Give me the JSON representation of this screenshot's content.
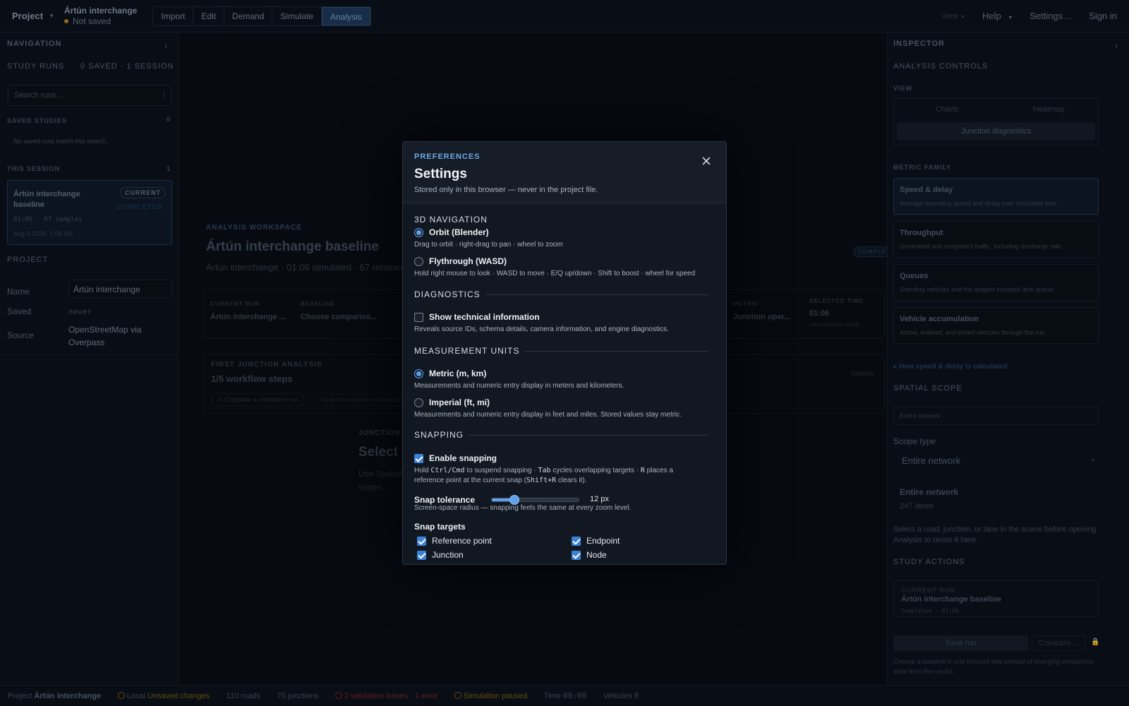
{
  "topbar": {
    "project_menu": "Project",
    "file_name": "Ártún interchange",
    "file_status": "Not saved",
    "menu": [
      "Import",
      "Edit",
      "Demand",
      "Simulate",
      "Analysis"
    ],
    "view": "View",
    "help": "Help",
    "settings": "Settings…",
    "sign_in": "Sign in"
  },
  "left": {
    "nav_title": "NAVIGATION",
    "study_runs": "STUDY RUNS",
    "study_counts": "0 SAVED · 1 SESSION",
    "search_placeholder": "Search runs…",
    "search_key": "/",
    "saved_studies": "SAVED STUDIES",
    "saved_count": "0",
    "no_saved": "No saved runs match this search.",
    "this_session": "THIS SESSION",
    "session_count": "1",
    "run": {
      "name": "Ártún interchange baseline",
      "badge": "CURRENT",
      "status": "COMPLETED",
      "meta": "01:06 · 67 samples",
      "date": "Aug 2 2026, 1:08 AM"
    },
    "project_title": "PROJECT",
    "name_label": "Name",
    "name_value": "Ártún interchange",
    "saved_label": "Saved",
    "saved_value": "never",
    "source_label": "Source",
    "source_value": "OpenStreetMap via Overpass"
  },
  "main": {
    "kicker": "ANALYSIS WORKSPACE",
    "title": "Ártún interchange baseline",
    "subtitle": "Ártún interchange · 01:06 simulated · 67 retained",
    "completed": "COMPLETED",
    "cards": [
      {
        "label": "CURRENT RUN",
        "value": "Ártún interchange ..."
      },
      {
        "label": "BASELINE",
        "value": "Choose compariso..."
      },
      {
        "label": "METRIC",
        "value": "Junction oper..."
      },
      {
        "label": "SELECTED TIME",
        "value": "01:06",
        "note": "Latest retained sample"
      }
    ],
    "workflow_kicker": "FIRST JUNCTION ANALYSIS",
    "workflow_title": "1/5 workflow steps",
    "workflow_dismiss": "Dismiss",
    "workflow_steps": [
      "Complete a simulation run",
      "Save the baseline comparison"
    ],
    "junction_kicker": "JUNCTION",
    "junction_title": "Select a",
    "junction_desc": "Use Spatial scope... substituted..."
  },
  "right": {
    "title": "INSPECTOR",
    "analysis_controls": "ANALYSIS CONTROLS",
    "view_label": "VIEW",
    "view_tabs": [
      "Charts",
      "Heatmap"
    ],
    "view_active": "Junction diagnostics",
    "metric_family": "METRIC FAMILY",
    "metrics": [
      {
        "title": "Speed & delay",
        "desc": "Average operating speed and delay over simulated time."
      },
      {
        "title": "Throughput",
        "desc": "Generated and completed traffic, including discharge rate."
      },
      {
        "title": "Queues",
        "desc": "Standing vehicles and the longest included lane queue."
      },
      {
        "title": "Vehicle accumulation",
        "desc": "Active, entered, and exited vehicles through the run."
      }
    ],
    "how_link": "How speed & delay is calculated",
    "spatial_scope": "SPATIAL SCOPE",
    "scope_chip": "Entire network",
    "scope_type_label": "Scope type",
    "scope_type_value": "Entire network",
    "scope_name": "Entire network",
    "scope_lanes": "247 lanes",
    "scope_hint": "Select a road, junction, or lane in the scene before opening Analysis to reuse it here.",
    "study_actions": "STUDY ACTIONS",
    "current_run_label": "CURRENT RUN",
    "current_run_name": "Ártún interchange baseline",
    "current_run_meta": "Completed · 01:06",
    "save_run": "Save run",
    "compare": "Compare…",
    "baseline_hint": "Choose a baseline in one focused step instead of changing comparison state from the run list."
  },
  "status": {
    "project_label": "Project",
    "project_name": "Ártún interchange",
    "local": "Local",
    "unsaved": "Unsaved changes",
    "roads": "110 roads",
    "junctions": "75 junctions",
    "validation": "2 validation issues · 1 error",
    "sim": "Simulation paused",
    "time_label": "Time",
    "time_value": "00:00",
    "vehicles_label": "Vehicles",
    "vehicles_value": "0"
  },
  "modal": {
    "kicker": "PREFERENCES",
    "title": "Settings",
    "subtitle": "Stored only in this browser — never in the project file.",
    "nav_section": "3D NAVIGATION",
    "orbit_label": "Orbit (Blender)",
    "orbit_desc": "Drag to orbit · right-drag to pan · wheel to zoom",
    "fly_label": "Flythrough (WASD)",
    "fly_desc": "Hold right mouse to look · WASD to move · E/Q up/down · Shift to boost · wheel for speed",
    "diag_section": "DIAGNOSTICS",
    "tech_label": "Show technical information",
    "tech_desc": "Reveals source IDs, schema details, camera information, and engine diagnostics.",
    "units_section": "MEASUREMENT UNITS",
    "metric_label": "Metric (m, km)",
    "metric_desc": "Measurements and numeric entry display in meters and kilometers.",
    "imperial_label": "Imperial (ft, mi)",
    "imperial_desc": "Measurements and numeric entry display in feet and miles. Stored values stay metric.",
    "snap_section": "SNAPPING",
    "snap_label": "Enable snapping",
    "snap_desc_1": "Hold",
    "snap_key_1": "Ctrl/Cmd",
    "snap_desc_2": "to suspend snapping ·",
    "snap_key_2": "Tab",
    "snap_desc_3": "cycles overlapping targets ·",
    "snap_key_3": "R",
    "snap_desc_4": "places a reference point at the current snap (",
    "snap_key_4": "Shift+R",
    "snap_desc_5": "clears it).",
    "tol_label": "Snap tolerance",
    "tol_value": "12 px",
    "tol_fraction": 0.26,
    "tol_desc": "Screen-space radius — snapping feels the same at every zoom level.",
    "targets_label": "Snap targets",
    "targets": [
      "Reference point",
      "Endpoint",
      "Junction",
      "Node"
    ]
  }
}
